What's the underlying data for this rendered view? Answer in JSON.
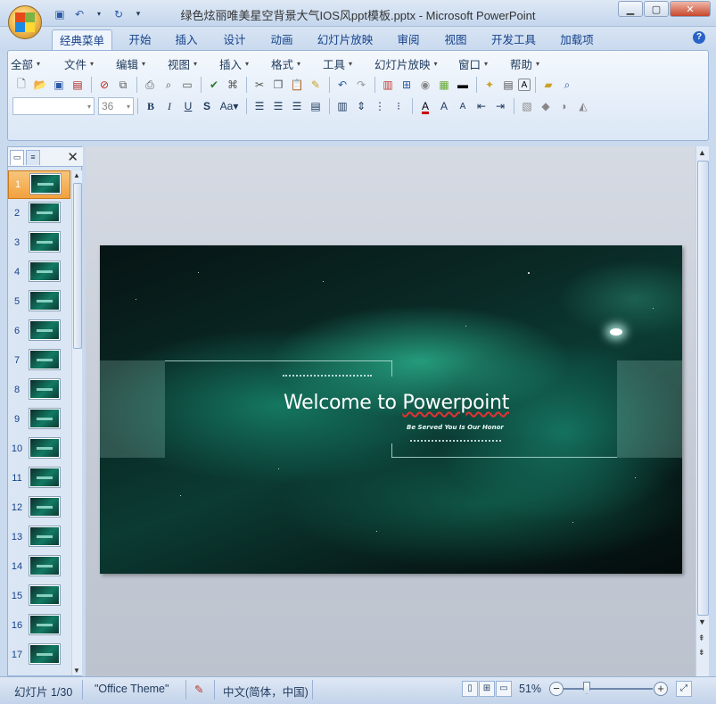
{
  "window": {
    "title": "绿色炫丽唯美星空背景大气IOS风ppt模板.pptx - Microsoft PowerPoint",
    "controls": [
      "minimize",
      "maximize",
      "close"
    ]
  },
  "quick_access": {
    "icons": [
      "save-icon",
      "undo-icon",
      "redo-icon",
      "customize-icon"
    ]
  },
  "tabs": [
    {
      "label": "经典菜单",
      "active": true
    },
    {
      "label": "开始"
    },
    {
      "label": "插入"
    },
    {
      "label": "设计"
    },
    {
      "label": "动画"
    },
    {
      "label": "幻灯片放映"
    },
    {
      "label": "审阅"
    },
    {
      "label": "视图"
    },
    {
      "label": "开发工具"
    },
    {
      "label": "加载项"
    }
  ],
  "classic_menu": [
    {
      "label": "全部"
    },
    {
      "label": "文件"
    },
    {
      "label": "编辑"
    },
    {
      "label": "视图"
    },
    {
      "label": "插入"
    },
    {
      "label": "格式"
    },
    {
      "label": "工具"
    },
    {
      "label": "幻灯片放映"
    },
    {
      "label": "窗口"
    },
    {
      "label": "帮助"
    }
  ],
  "format_bar": {
    "font_name": "",
    "font_size": "36"
  },
  "slides_panel": {
    "slide_numbers": [
      "1",
      "2",
      "3",
      "4",
      "5",
      "6",
      "7",
      "8",
      "9",
      "10",
      "11",
      "12",
      "13",
      "14",
      "15",
      "16",
      "17"
    ],
    "selected": "1"
  },
  "slide": {
    "title_prefix": "Welcome to ",
    "title_word": "Powerpoint",
    "subtitle": "Be Served You Is Our Honor"
  },
  "status": {
    "slide_info": "幻灯片 1/30",
    "theme": "\"Office Theme\"",
    "language": "中文(简体，中国)",
    "zoom": "51%"
  },
  "colors": {
    "accent": "#15428b",
    "ribbon": "#dbe7f6",
    "slide_teal": "#127a63"
  }
}
